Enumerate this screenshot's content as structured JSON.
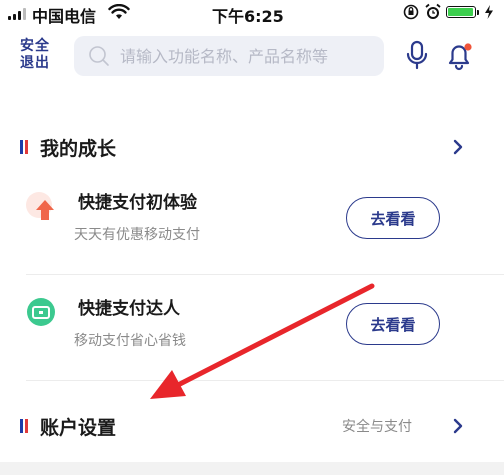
{
  "status_bar": {
    "carrier": "中国电信",
    "time": "下午6:25",
    "battery_level": 0.95
  },
  "header": {
    "logout_line1": "安全",
    "logout_line2": "退出",
    "search_placeholder": "请输入功能名称、产品名称等"
  },
  "growth_section": {
    "title": "我的成长",
    "items": [
      {
        "title": "快捷支付初体验",
        "description": "天天有优惠移动支付",
        "button_label": "去看看",
        "icon": "arrow-up-icon"
      },
      {
        "title": "快捷支付达人",
        "description": "移动支付省心省钱",
        "button_label": "去看看",
        "icon": "wallet-icon"
      }
    ]
  },
  "account_section": {
    "title": "账户设置",
    "extra": "安全与支付"
  },
  "colors": {
    "accent": "#2b3a8c",
    "flag_blue": "#1d3ba8",
    "flag_red": "#e03a3a",
    "annotation": "#e8262b",
    "up_icon": "#f0664a",
    "wallet_icon": "#3cc98f"
  }
}
